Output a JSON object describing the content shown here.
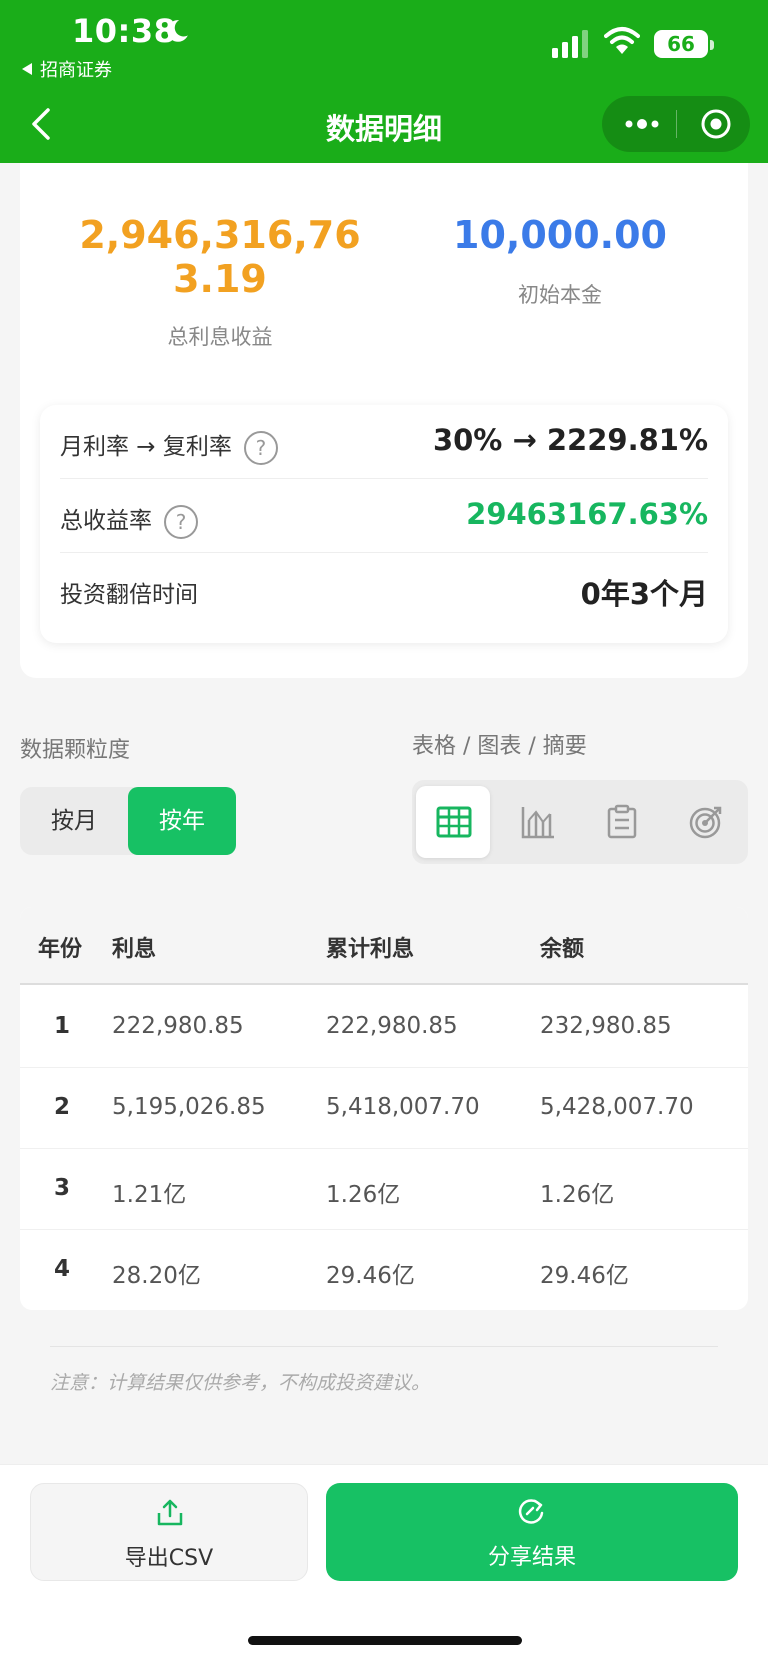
{
  "status_bar": {
    "time": "10:38",
    "back_app": "招商证券",
    "battery": "66"
  },
  "nav": {
    "title": "数据明细"
  },
  "summary": {
    "total_interest": "2,946,316,763.19",
    "total_interest_label": "总利息收益",
    "principal": "10,000.00",
    "principal_label": "初始本金"
  },
  "metrics": {
    "rate_label": "月利率 → 复利率",
    "rate_value": "30% → 2229.81%",
    "return_label": "总收益率",
    "return_value": "29463167.63%",
    "double_label": "投资翻倍时间",
    "double_value": "0年3个月",
    "help_symbol": "?"
  },
  "controls": {
    "granularity_label": "数据颗粒度",
    "view_label": "表格 / 图表 / 摘要",
    "toggle_month": "按月",
    "toggle_year": "按年",
    "active_toggle": "按年",
    "view_icons": [
      "table-icon",
      "chart-icon",
      "summary-icon",
      "target-icon"
    ]
  },
  "table": {
    "headers": [
      "年份",
      "利息",
      "累计利息",
      "余额"
    ],
    "rows": [
      [
        "1",
        "222,980.85",
        "222,980.85",
        "232,980.85"
      ],
      [
        "2",
        "5,195,026.85",
        "5,418,007.70",
        "5,428,007.70"
      ],
      [
        "3",
        "1.21亿",
        "1.26亿",
        "1.26亿"
      ],
      [
        "4",
        "28.20亿",
        "29.46亿",
        "29.46亿"
      ]
    ]
  },
  "note": "注意：计算结果仅供参考，不构成投资建议。",
  "actions": {
    "export_label": "导出CSV",
    "share_label": "分享结果"
  },
  "colors": {
    "brand_green": "#1aad19",
    "accent_green": "#17c164",
    "orange": "#f2a121",
    "blue": "#3b7be8"
  }
}
